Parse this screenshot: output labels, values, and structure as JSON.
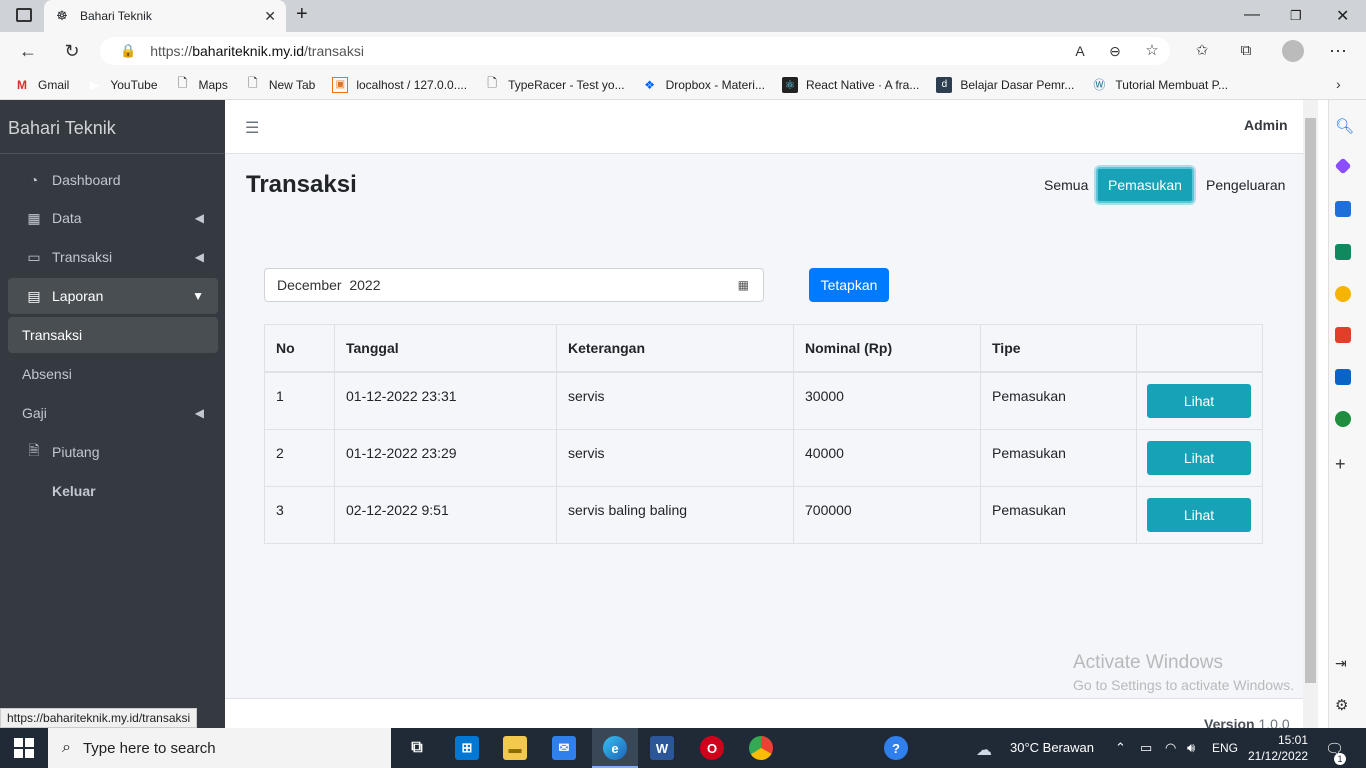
{
  "browser": {
    "tab_title": "Bahari Teknik",
    "url_prefix": "https://",
    "url_host": "bahariteknik.my.id",
    "url_path": "/transaksi",
    "bookmarks": [
      "Gmail",
      "YouTube",
      "Maps",
      "New Tab",
      "localhost / 127.0.0....",
      "TypeRacer - Test yo...",
      "Dropbox - Materi...",
      "React Native · A fra...",
      "Belajar Dasar Pemr...",
      "Tutorial Membuat P..."
    ]
  },
  "sidebar": {
    "brand": "Bahari Teknik",
    "items": [
      {
        "label": "Dashboard",
        "icon": "tachometer-icon"
      },
      {
        "label": "Data",
        "icon": "table-icon"
      },
      {
        "label": "Transaksi",
        "icon": "credit-card-icon"
      },
      {
        "label": "Laporan",
        "icon": "book-icon"
      },
      {
        "label": "Transaksi"
      },
      {
        "label": "Absensi"
      },
      {
        "label": "Gaji"
      },
      {
        "label": "Piutang",
        "icon": "file-invoice-icon"
      },
      {
        "label": "Keluar"
      }
    ],
    "status_url": "https://bahariteknik.my.id/transaksi"
  },
  "header": {
    "user": "Admin"
  },
  "main": {
    "title": "Transaksi",
    "filters": [
      "Semua",
      "Pemasukan",
      "Pengeluaran"
    ],
    "selected_filter": "Pemasukan",
    "month_value": "December  2022",
    "apply_label": "Tetapkan",
    "columns": [
      "No",
      "Tanggal",
      "Keterangan",
      "Nominal (Rp)",
      "Tipe",
      ""
    ],
    "rows": [
      {
        "no": "1",
        "tanggal": "01-12-2022 23:31",
        "keterangan": "servis",
        "nominal": "30000",
        "tipe": "Pemasukan",
        "action": "Lihat"
      },
      {
        "no": "2",
        "tanggal": "01-12-2022 23:29",
        "keterangan": "servis",
        "nominal": "40000",
        "tipe": "Pemasukan",
        "action": "Lihat"
      },
      {
        "no": "3",
        "tanggal": "02-12-2022 9:51",
        "keterangan": "servis baling baling",
        "nominal": "700000",
        "tipe": "Pemasukan",
        "action": "Lihat"
      }
    ]
  },
  "footer": {
    "version_label": "Version",
    "version_value": "1.0.0"
  },
  "watermark": {
    "line1": "Activate Windows",
    "line2": "Go to Settings to activate Windows."
  },
  "taskbar": {
    "search_placeholder": "Type here to search",
    "weather": "30°C  Berawan",
    "lang": "ENG",
    "time": "15:01",
    "date": "21/12/2022",
    "notification_count": "1"
  },
  "colors": {
    "sidebar_bg": "#343a40",
    "accent_info": "#17a2b8",
    "primary": "#007bff"
  }
}
